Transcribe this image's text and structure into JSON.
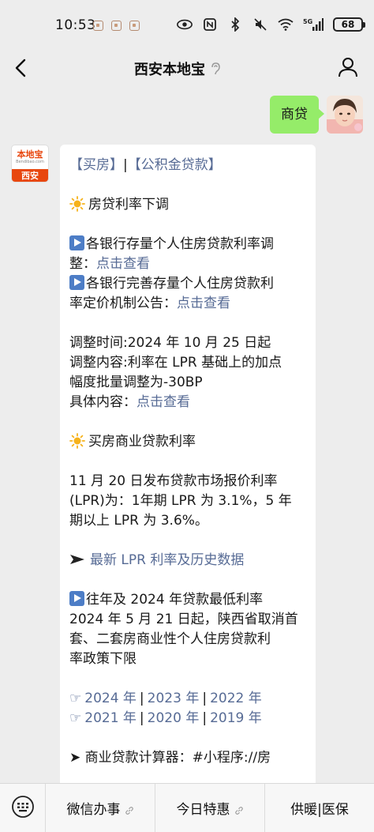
{
  "status_bar": {
    "time": "10:53",
    "network": "5G",
    "battery": "68"
  },
  "nav": {
    "title": "西安本地宝",
    "icons": [
      "back-arrow-icon",
      "ear-icon",
      "person-icon"
    ]
  },
  "outgoing_message": {
    "text": "商贷"
  },
  "incoming_avatar": {
    "brand": "本地宝",
    "brand_sub": "Bendibao.com",
    "city": "西安"
  },
  "message": {
    "header_buy": "【买房】",
    "header_sep": "|",
    "header_fund": "【公积金贷款】",
    "rate_down_title": "房贷利率下调",
    "item1_text_a": "各银行存量个人住房贷款利率调",
    "item1_text_b": "整：",
    "item1_link": "点击查看",
    "item2_text_a": "各银行完善存量个人住房贷款利",
    "item2_text_b": "率定价机制公告：",
    "item2_link": "点击查看",
    "adjust_time": "调整时间:2024 年 10 月 25 日起",
    "adjust_content_a": "调整内容:利率在 LPR 基础上的加点",
    "adjust_content_b": "幅度批量调整为-30BP",
    "detail_label": "具体内容：",
    "detail_link": "点击查看",
    "commercial_title": "买房商业贷款利率",
    "lpr_line1": "11 月 20 日发布贷款市场报价利率",
    "lpr_line2": "(LPR)为：1年期 LPR 为 3.1%，5 年",
    "lpr_line3": "期以上 LPR 为 3.6%。",
    "latest_lpr_link": "最新 LPR 利率及历史数据",
    "min_rate_title": "往年及 2024 年贷款最低利率",
    "min_rate_line1": "2024 年 5 月 21 日起，陕西省取消首",
    "min_rate_line2": "套、二套房商业性个人住房贷款利",
    "min_rate_line3": "率政策下限",
    "year_links_row1": [
      "2024 年",
      "2023 年",
      "2022 年"
    ],
    "year_links_row2": [
      "2021 年",
      "2020 年",
      "2019 年"
    ],
    "cutoff_line": "➤ 商业贷款计算器：#小程序://房"
  },
  "bottom_menu": {
    "items": [
      "微信办事",
      "今日特惠",
      "供暖|医保"
    ]
  },
  "colors": {
    "background": "#ededed",
    "outgoing_bubble": "#95ec69",
    "link": "#576b95",
    "brand_orange": "#e8470f"
  }
}
